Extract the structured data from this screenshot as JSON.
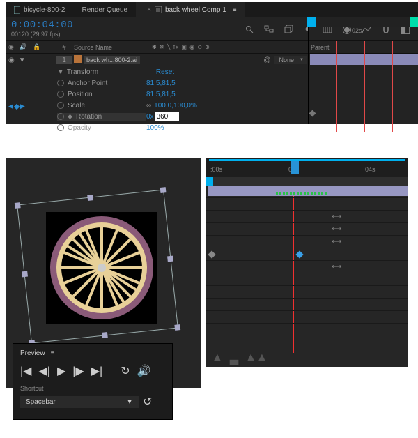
{
  "tabs": [
    {
      "label": "bicycle-800-2",
      "active": false,
      "icon": "doc"
    },
    {
      "label": "Render Queue",
      "active": false,
      "icon": ""
    },
    {
      "label": "back wheel Comp 1",
      "active": true,
      "icon": "comp"
    }
  ],
  "timecode": "0:00:04:00",
  "timecode_sub": "00120 (29.97 fps)",
  "columns": {
    "source": "Source Name",
    "parent": "Parent"
  },
  "layer": {
    "index": "1",
    "name": "back wh...800-2.ai",
    "parent": "None"
  },
  "transform": {
    "label": "Transform",
    "reset": "Reset"
  },
  "props": {
    "anchor": {
      "name": "Anchor Point",
      "val": "81,5,81,5"
    },
    "position": {
      "name": "Position",
      "val": "81,5,81,5"
    },
    "scale": {
      "name": "Scale",
      "val": "100,0,100,0%",
      "link": "∞"
    },
    "rotation": {
      "name": "Rotation",
      "mult": "0x",
      "val": "360"
    },
    "opacity": {
      "name": "Opacity",
      "val": "100%"
    }
  },
  "top_ruler": {
    "ticks": [
      "0",
      "02s"
    ]
  },
  "preview": {
    "title": "Preview",
    "shortcut_label": "Shortcut",
    "shortcut_value": "Spacebar"
  },
  "bt_ruler": {
    "ticks": [
      ":00s",
      "02s",
      "04s"
    ]
  },
  "colors": {
    "accent": "#00b0ee",
    "link": "#2a8bd0",
    "playhead": "#f03030"
  }
}
